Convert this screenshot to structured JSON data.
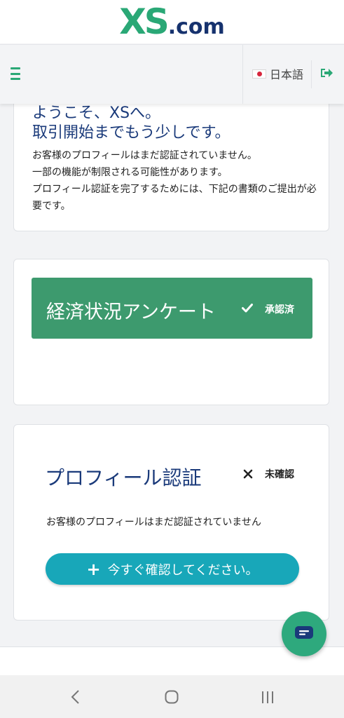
{
  "brand": {
    "logo_main": "XS",
    "logo_suffix": ".com"
  },
  "nav": {
    "menu_icon": "hamburger-menu-icon",
    "language_flag": "japan-flag-icon",
    "language_label": "日本語",
    "logout_icon": "logout-icon"
  },
  "welcome": {
    "title_line1": "ようこそ、XSへ。",
    "title_line2": "取引開始までもう少しです。",
    "body": [
      "お客様のプロフィールはまだ認証されていません。",
      "一部の機能が制限される可能性があります。",
      "プロフィール認証を完了するためには、下記の書類のご提出が必要です。"
    ]
  },
  "survey": {
    "title": "経済状況アンケート",
    "status_icon": "check-icon",
    "status": "承認済"
  },
  "profile": {
    "title": "プロフィール認証",
    "status_icon": "close-icon",
    "status": "未確認",
    "message": "お客様のプロフィールはまだ認証されていません",
    "button_icon": "plus-icon",
    "button_label": "今すぐ確認してください。"
  },
  "chat": {
    "icon": "chat-icon"
  },
  "system_nav": {
    "back_icon": "back-icon",
    "home_icon": "home-icon",
    "recents_icon": "recents-icon"
  },
  "colors": {
    "brand_green": "#2aa876",
    "brand_navy": "#16326e",
    "survey_green": "#3d9a6e",
    "button_teal": "#18a7b9",
    "title_blue": "#1a3a7a"
  }
}
